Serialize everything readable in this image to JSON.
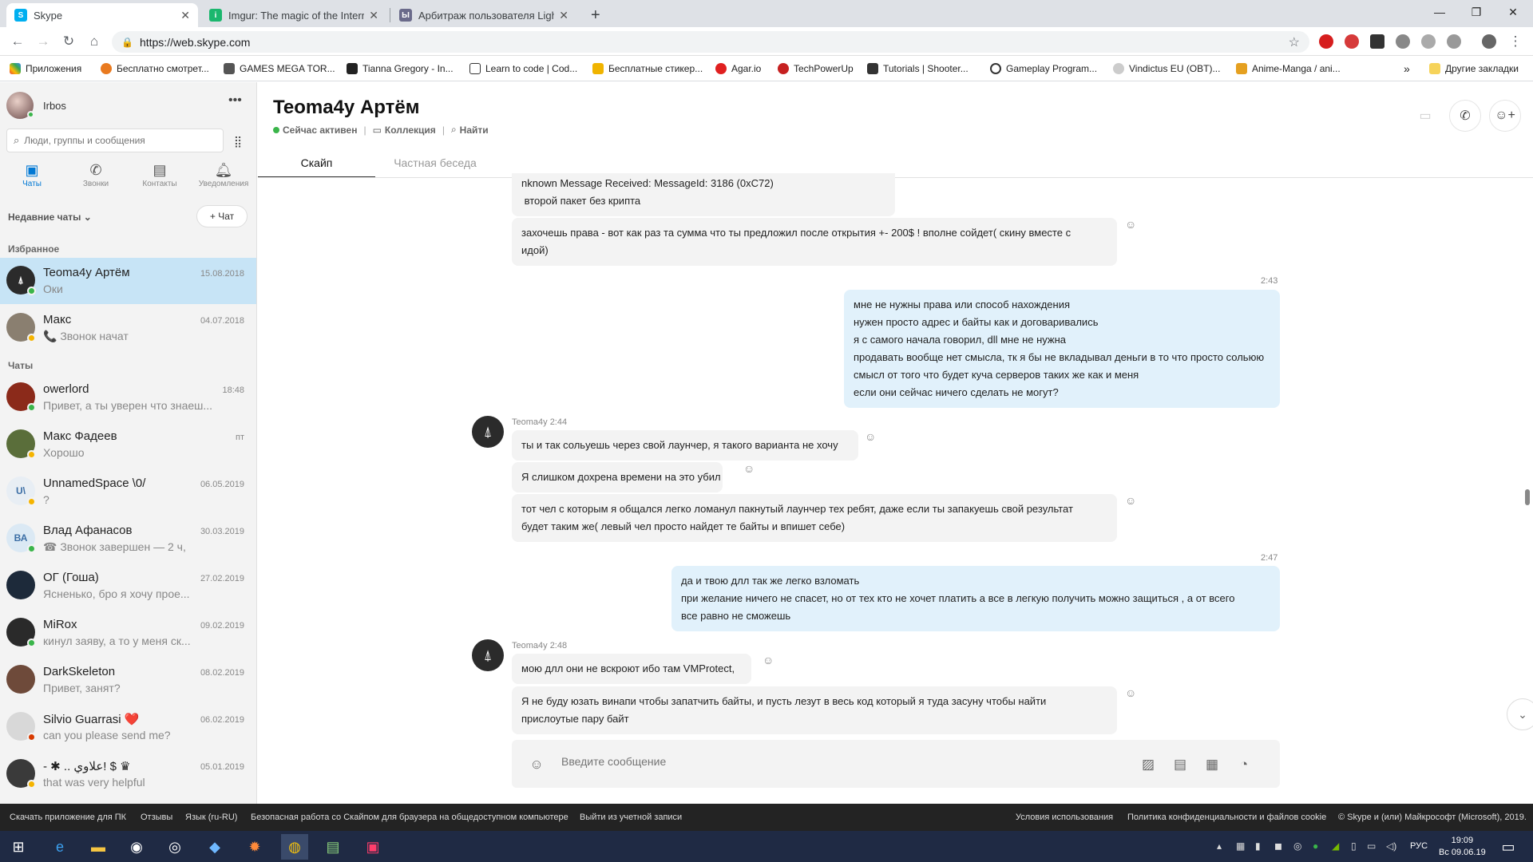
{
  "browser": {
    "tabs": [
      {
        "title": "Skype",
        "favicon_color": "#00aff0",
        "icon": "skype-icon"
      },
      {
        "title": "Imgur: The magic of the Internet",
        "favicon_color": "#1bb76e",
        "icon": "imgur-icon"
      },
      {
        "title": "Арбитраж пользователя LightF",
        "favicon_color": "#6a6a8a",
        "icon": "forum-icon"
      }
    ],
    "url": "https://web.skype.com",
    "bookmarks": [
      "Приложения",
      "Бесплатно смотрет...",
      "GAMES MEGA TOR...",
      "Tianna Gregory - In...",
      "Learn to code | Cod...",
      "Бесплатные стикер...",
      "Agar.io",
      "TechPowerUp",
      "Tutorials | Shooter...",
      "Gameplay Program...",
      "Vindictus EU (OBT)...",
      "Anime-Manga / ani..."
    ],
    "other_bookmarks": "Другие закладки",
    "more_bookmarks": "»"
  },
  "sidebar": {
    "user_name": "Irbos",
    "more": "•••",
    "search_placeholder": "Люди, группы и сообщения",
    "tabs": [
      {
        "label": "Чаты",
        "icon": "chat-icon"
      },
      {
        "label": "Звонки",
        "icon": "phone-icon"
      },
      {
        "label": "Контакты",
        "icon": "contacts-icon"
      },
      {
        "label": "Уведомления",
        "icon": "bell-icon"
      }
    ],
    "recent_label": "Недавние чаты",
    "new_chat": "+ Чат",
    "favorites_label": "Избранное",
    "chats_label": "Чаты",
    "favorites": [
      {
        "name": "Teoma4y Артём",
        "preview": "Оки",
        "date": "15.08.2018",
        "status": "online",
        "initials": "",
        "color": "#2b2b2b"
      },
      {
        "name": "Макс",
        "preview": "📞 Звонок начат",
        "date": "04.07.2018",
        "status": "away",
        "initials": "",
        "color": "#8a7f70"
      }
    ],
    "chats": [
      {
        "name": "owerlord",
        "preview": "Привет, а ты уверен что знаеш...",
        "date": "18:48",
        "status": "online",
        "initials": "",
        "color": "#8b2a1a"
      },
      {
        "name": "Макс Фадеев",
        "preview": "Хорошо",
        "date": "пт",
        "status": "away",
        "initials": "",
        "color": "#5a6e3a"
      },
      {
        "name": "UnnamedSpace \\0/",
        "preview": "?",
        "date": "06.05.2019",
        "status": "away",
        "initials": "U\\",
        "color": "#e8eef4"
      },
      {
        "name": "Влад Афанасов",
        "preview": "☎ Звонок завершен — 2 ч,",
        "date": "30.03.2019",
        "status": "online",
        "initials": "ВА",
        "color": "#dbe9f4"
      },
      {
        "name": "ОГ (Гоша)",
        "preview": "Ясненько, бро я хочу прое...",
        "date": "27.02.2019",
        "status": "none",
        "initials": "",
        "color": "#1d2a3a"
      },
      {
        "name": "MiRox",
        "preview": "кинул заяву, а то у меня ск...",
        "date": "09.02.2019",
        "status": "online",
        "initials": "",
        "color": "#2a2a2a"
      },
      {
        "name": "DarkSkeleton",
        "preview": "Привет, занят?",
        "date": "08.02.2019",
        "status": "none",
        "initials": "",
        "color": "#6e4a3a"
      },
      {
        "name": "Silvio Guarrasi ❤️",
        "preview": "can you please send me?",
        "date": "06.02.2019",
        "status": "busy",
        "initials": "",
        "color": "#d8d8d8"
      },
      {
        "name": "- ✱ .. علاوي! $ ♛",
        "preview": "that was very helpful",
        "date": "05.01.2019",
        "status": "away",
        "initials": "",
        "color": "#3a3a3a"
      }
    ]
  },
  "conversation": {
    "title": "Teoma4y Артём",
    "status": "Сейчас активен",
    "collection": "Коллекция",
    "find": "Найти",
    "tab_skype": "Скайп",
    "tab_private": "Частная беседа",
    "messages": {
      "m1_l1": "nknown Message Received: MessageId: 3186 (0xC72)",
      "m1_l2": " второй пакет без крипта",
      "m2_l1": "захочешь права - вот как раз та сумма что ты предложил после открытия +- 200$ ! вполне сойдет( скину вместе с",
      "m2_l2": "идой)",
      "t1": "2:43",
      "m3_l1": "мне не нужны права или способ нахождения",
      "m3_l2": "нужен просто адрес и байты как и договаривались",
      "m3_l3": "я с самого начала говорил, dll мне не нужна",
      "m3_l4": "продавать вообще нет смысла, тк я бы не вкладывал деньги в то что просто сольюю",
      "m3_l5": "смысл от того что будет куча серверов таких же как и меня",
      "m3_l6": "если они сейчас ничего сделать не могут?",
      "meta1": "Teoma4y 2:44",
      "m4": "ты и так сольуешь через свой лаунчер, я такого варианта не хочу",
      "m5": "Я слишком дохрена времени на это убил",
      "m6_l1": "тот чел с которым я общался легко ломанул пакнутый лаунчер тех ребят, даже если ты запакуешь свой результат",
      "m6_l2": "будет таким же( левый чел просто найдет те байты и впишет себе)",
      "t2": "2:47",
      "m7_l1": "да и твою длл так же легко взломать",
      "m7_l2": "при желание ничего не спасет, но от тех кто не хочет платить а все в легкую получить можно защиться , а от всего",
      "m7_l3": "все равно не сможешь",
      "meta2": "Teoma4y 2:48",
      "m8": "мою длл они не вскроют ибо там VMProtect,",
      "m9_l1": "Я не буду юзать винапи чтобы запатчить байты, и пусть лезут в весь код который я туда засуну чтобы найти",
      "m9_l2": "прислоутые пару байт"
    },
    "composer_placeholder": "Введите сообщение",
    "react_icon": "☺"
  },
  "footer": {
    "left": [
      "Скачать приложение для ПК",
      "Отзывы",
      "Язык (ru-RU)",
      "Безопасная работа со Скайпом для браузера на общедоступном компьютере",
      "Выйти из учетной записи"
    ],
    "right": [
      "Условия использования",
      "Политика конфиденциальности и файлов cookie",
      "© Skype и (или) Майкрософт (Microsoft), 2019."
    ]
  },
  "taskbar": {
    "lang": "РУС",
    "time": "19:09",
    "date": "Вс 09.06.19"
  },
  "colors": {
    "accent": "#0078d4",
    "online": "#3ab54a",
    "away": "#f5b400",
    "busy": "#d83b01"
  }
}
